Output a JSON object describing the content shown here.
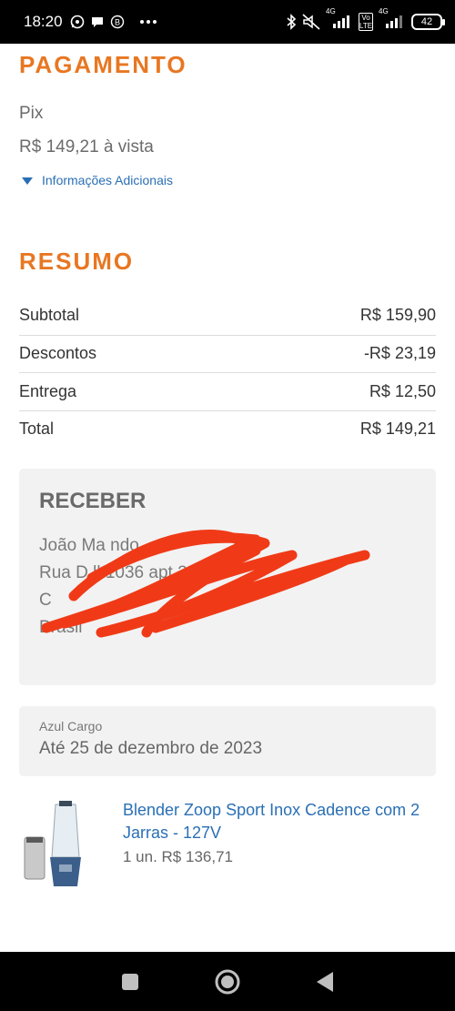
{
  "status_bar": {
    "time": "18:20",
    "network_1": "4G",
    "network_2": "4G",
    "volte": "Vo LTE",
    "battery": "42",
    "icons": [
      "whatsapp-icon",
      "chat-bubble-icon",
      "b-circle-icon",
      "more-dots-icon",
      "bluetooth-icon",
      "mute-icon",
      "signal-icon",
      "signal-icon",
      "battery-icon"
    ]
  },
  "payment": {
    "title": "PAGAMENTO",
    "method": "Pix",
    "amount": "R$ 149,21 à vista",
    "info_link": "Informações Adicionais"
  },
  "summary": {
    "title": "RESUMO",
    "rows": [
      {
        "label": "Subtotal",
        "value": "R$ 159,90"
      },
      {
        "label": "Descontos",
        "value": "-R$ 23,19"
      },
      {
        "label": "Entrega",
        "value": "R$ 12,50"
      },
      {
        "label": "Total",
        "value": "R$ 149,21"
      }
    ]
  },
  "receive": {
    "title": "RECEBER",
    "lines": [
      "João Ma        ndo",
      "Rua D          ll 1036   apt 24",
      "C",
      "",
      "Brasil"
    ]
  },
  "shipping": {
    "carrier": "Azul Cargo",
    "estimate": "Até 25 de dezembro de 2023"
  },
  "product": {
    "name": "Blender Zoop Sport Inox Cadence com 2 Jarras - 127V",
    "qty_price": "1 un. R$ 136,71"
  },
  "colors": {
    "accent": "#e87722",
    "link": "#2a6fb5",
    "scribble": "#f03a17"
  }
}
